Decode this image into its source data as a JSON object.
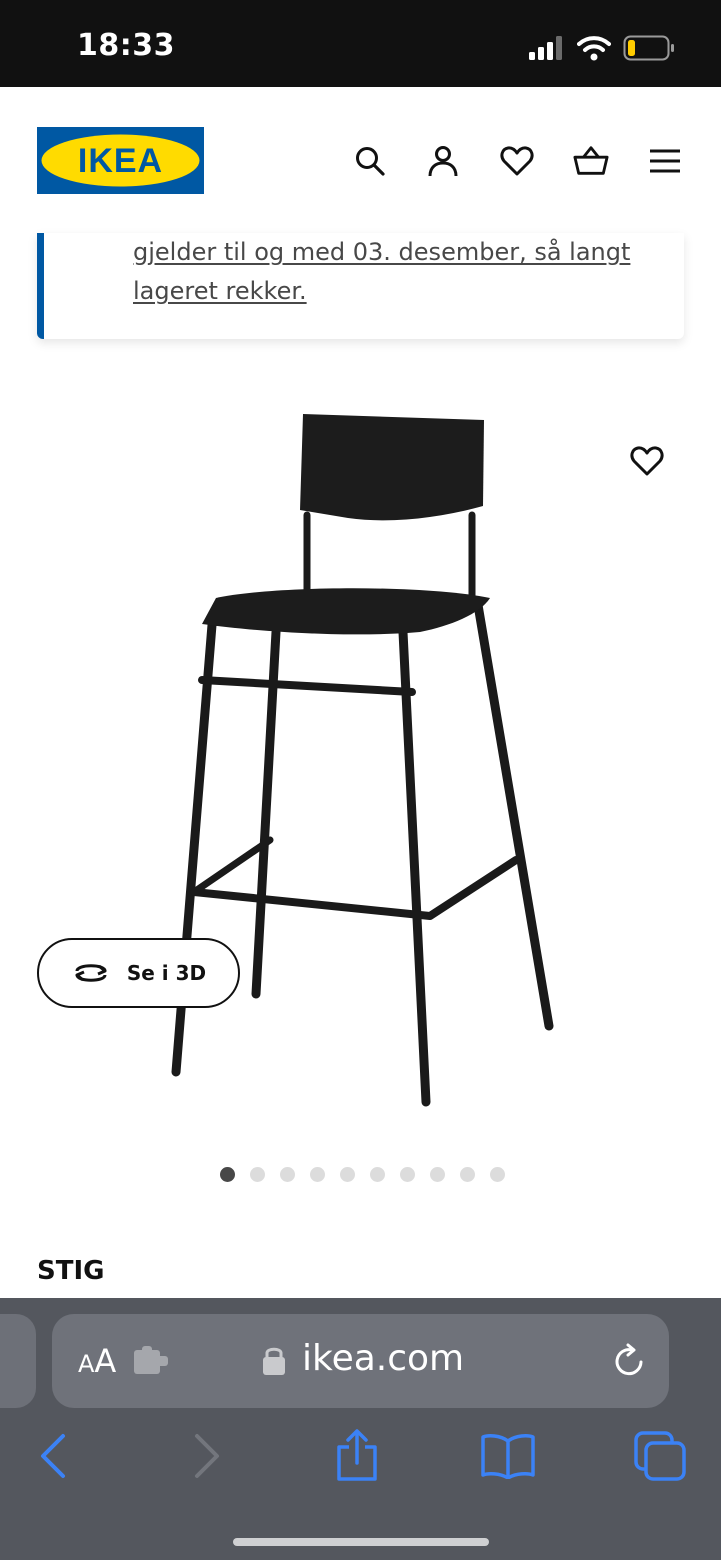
{
  "status_bar": {
    "time": "18:33"
  },
  "header": {
    "logo_text": "IKEA",
    "icons": [
      "search-icon",
      "account-icon",
      "favorites-icon",
      "cart-icon",
      "menu-icon"
    ]
  },
  "notice": {
    "text": "gjelder til og med 03. desember, så langt lageret rekker."
  },
  "product": {
    "name": "STIG",
    "view_3d_label": "Se i 3D",
    "carousel": {
      "total": 10,
      "active_index": 0
    }
  },
  "browser": {
    "aa_small": "A",
    "aa_big": "A",
    "url": "ikea.com"
  },
  "colors": {
    "ikea_blue": "#0058a3",
    "ikea_yellow": "#ffdb00",
    "notice_accent": "#0058a3",
    "safari_bar": "#54575e",
    "safari_toolbar_icons": "#3b82f6"
  }
}
